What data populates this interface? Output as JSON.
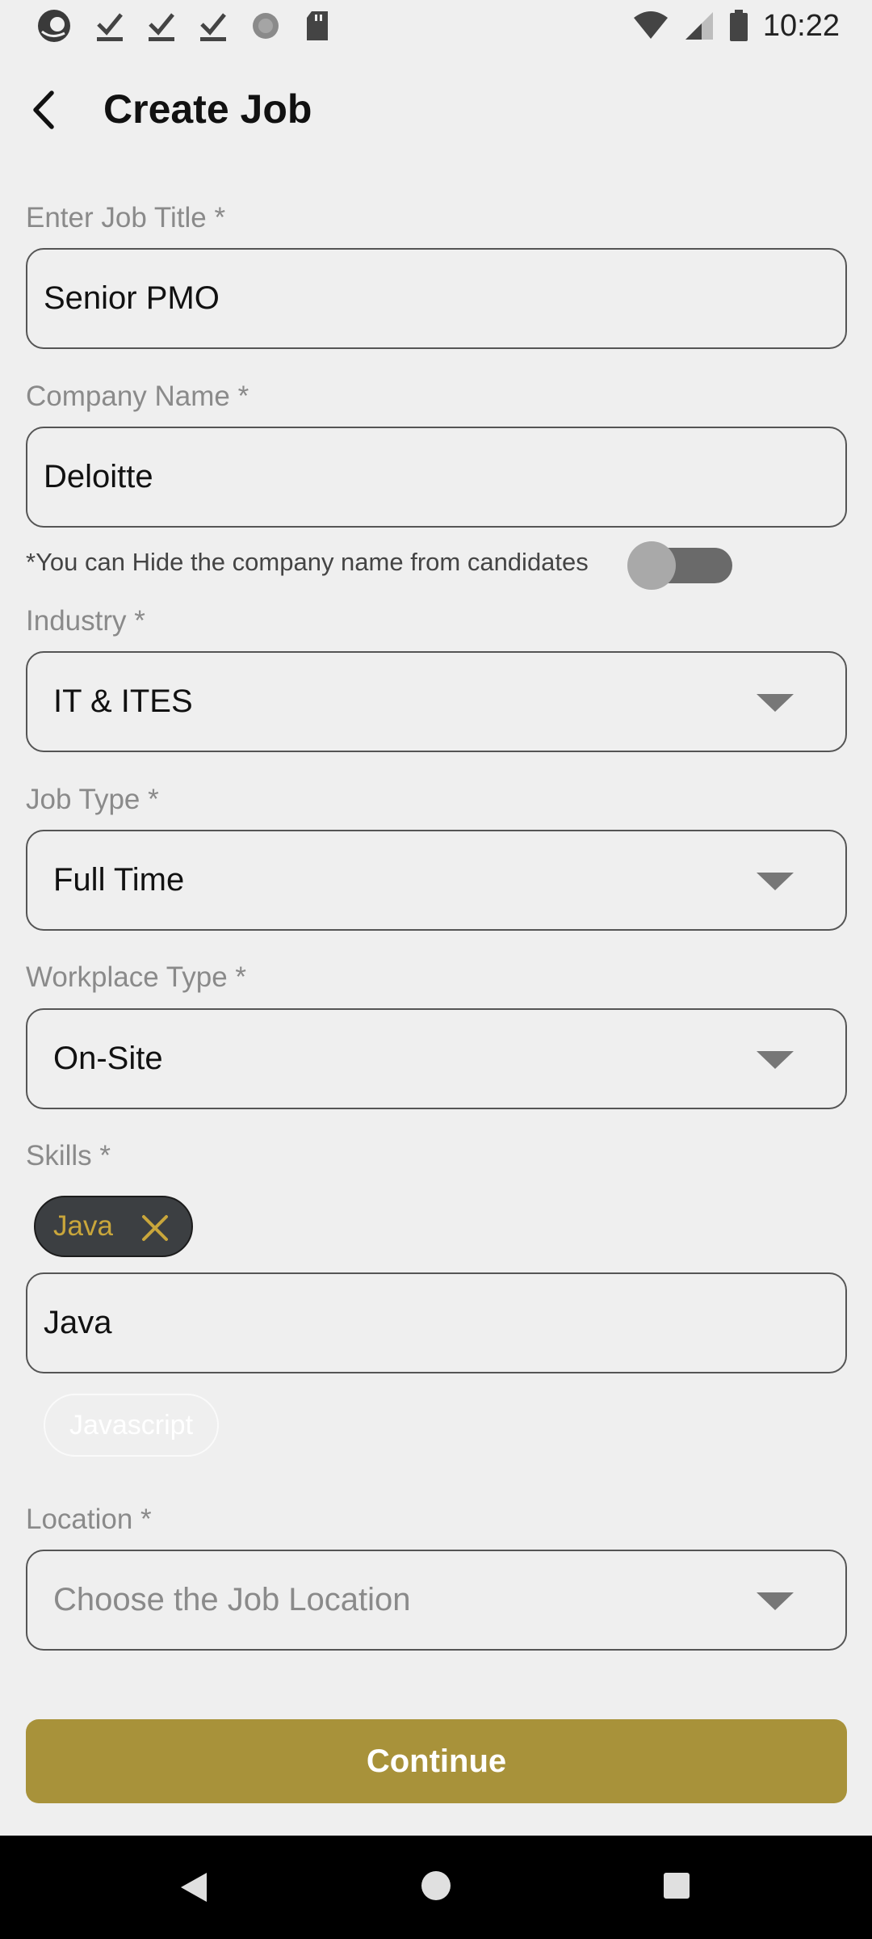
{
  "status_bar": {
    "time": "10:22",
    "left_icons": [
      "app-logo-icon",
      "download-done-icon",
      "download-done-icon",
      "download-done-icon",
      "loading-icon",
      "sd-card-icon"
    ],
    "right_icons": [
      "wifi-icon",
      "cell-signal-icon",
      "battery-icon"
    ]
  },
  "header": {
    "title": "Create Job",
    "back_icon": "arrow-back-icon"
  },
  "form": {
    "job_title": {
      "label": "Enter Job Title *",
      "value": "Senior PMO"
    },
    "company_name": {
      "label": "Company Name *",
      "value": "Deloitte"
    },
    "hide_company": {
      "note": "*You can Hide the company name from candidates",
      "enabled": false
    },
    "industry": {
      "label": "Industry *",
      "value": "IT & ITES"
    },
    "job_type": {
      "label": "Job Type *",
      "value": "Full Time"
    },
    "workplace_type": {
      "label": "Workplace Type *",
      "value": "On-Site"
    },
    "skills": {
      "label": "Skills *",
      "selected": [
        {
          "label": "Java"
        }
      ],
      "input_value": "Java",
      "suggestions": [
        {
          "label": "Javascript"
        }
      ]
    },
    "location": {
      "label": "Location *",
      "placeholder": "Choose the Job Location"
    }
  },
  "actions": {
    "continue_label": "Continue"
  },
  "colors": {
    "accent": "#a8923a",
    "chip_bg": "#3c3f42",
    "chip_text": "#c9a63b",
    "background": "#efefef"
  }
}
